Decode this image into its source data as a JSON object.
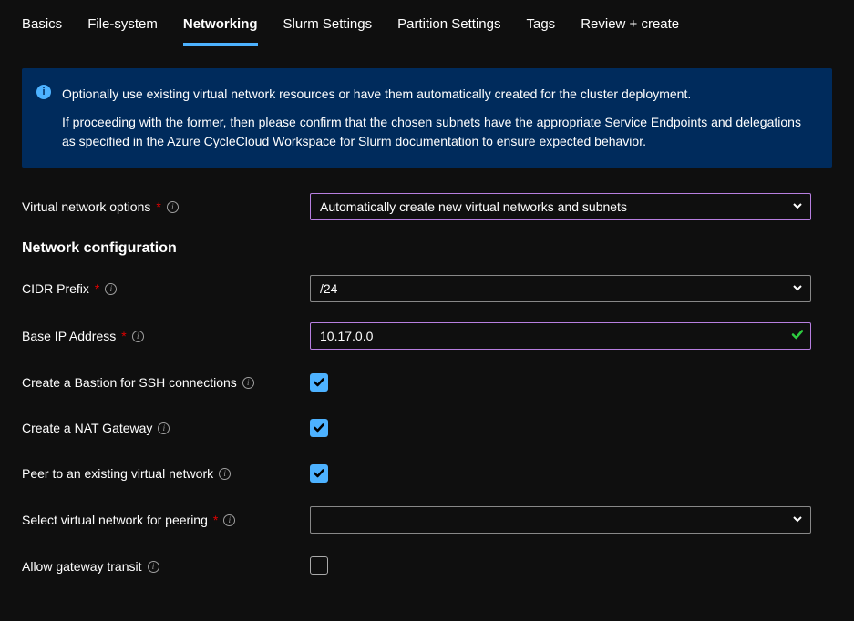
{
  "tabs": [
    {
      "label": "Basics"
    },
    {
      "label": "File-system"
    },
    {
      "label": "Networking",
      "active": true
    },
    {
      "label": "Slurm Settings"
    },
    {
      "label": "Partition Settings"
    },
    {
      "label": "Tags"
    },
    {
      "label": "Review + create"
    }
  ],
  "info": {
    "p1": "Optionally use existing virtual network resources or have them automatically created for the cluster deployment.",
    "p2": "If proceeding with the former, then please confirm that the chosen subnets have the appropriate Service Endpoints and delegations as specified in the Azure CycleCloud Workspace for Slurm documentation to ensure expected behavior."
  },
  "fields": {
    "vnet_options_label": "Virtual network options",
    "vnet_options_value": "Automatically create new virtual networks and subnets",
    "section_title": "Network configuration",
    "cidr_label": "CIDR Prefix",
    "cidr_value": "/24",
    "base_ip_label": "Base IP Address",
    "base_ip_value": "10.17.0.0",
    "bastion_label": "Create a Bastion for SSH connections",
    "nat_label": "Create a NAT Gateway",
    "peer_label": "Peer to an existing virtual network",
    "peer_select_label": "Select virtual network for peering",
    "peer_select_value": "",
    "gateway_label": "Allow gateway transit",
    "required_mark": "*"
  },
  "checks": {
    "bastion": true,
    "nat": true,
    "peer": true,
    "gateway": false
  }
}
